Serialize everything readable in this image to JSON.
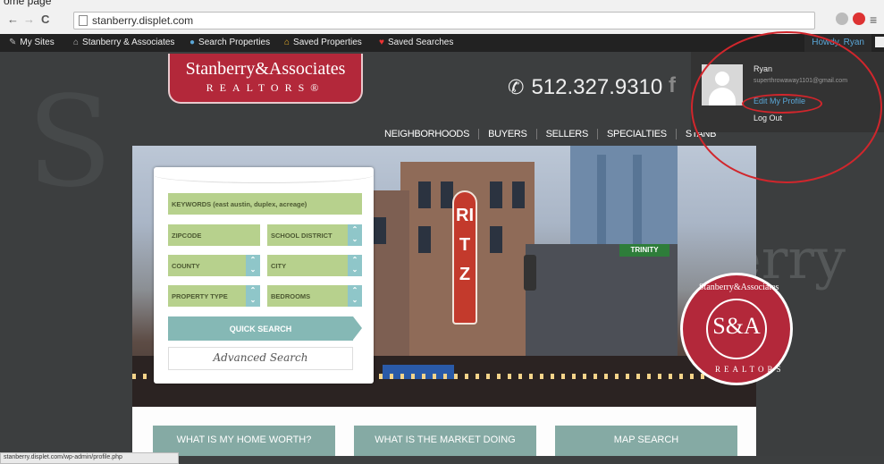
{
  "browser": {
    "partial_title": "ome page",
    "url": "stanberry.displet.com",
    "status_url": "stanberry.displet.com/wp-admin/profile.php"
  },
  "adminbar": {
    "items": [
      {
        "label": "My Sites",
        "icon": "wrench-icon"
      },
      {
        "label": "Stanberry & Associates",
        "icon": "home-icon"
      },
      {
        "label": "Search Properties",
        "icon": "search-icon"
      },
      {
        "label": "Saved Properties",
        "icon": "house-icon"
      },
      {
        "label": "Saved Searches",
        "icon": "heart-icon"
      }
    ],
    "howdy": "Howdy, Ryan"
  },
  "user_menu": {
    "name": "Ryan",
    "email": "superthrowaway1101@gmail.com",
    "edit_profile": "Edit My Profile",
    "logout": "Log Out"
  },
  "site": {
    "logo_line1": "Stanberry&Associates",
    "logo_line2": "REALTORS®",
    "phone": "512.327.9310",
    "nav": [
      "NEIGHBORHOODS",
      "BUYERS",
      "SELLERS",
      "SPECIALTIES",
      "STANB"
    ],
    "watermark": "erry"
  },
  "search": {
    "keywords": "KEYWORDS (east austin, duplex, acreage)",
    "zipcode": "ZIPCODE",
    "school_district": "SCHOOL DISTRICT",
    "county": "COUNTY",
    "city": "CITY",
    "property_type": "PROPERTY TYPE",
    "bedrooms": "BEDROOMS",
    "quick_search": "QUICK SEARCH",
    "advanced_search": "Advanced Search"
  },
  "hero": {
    "sign_text": "RITZ",
    "street_sign": "TRINITY"
  },
  "seal": {
    "top": "Stanberry&Associates",
    "center": "S&A",
    "bottom": "REALTORS"
  },
  "cta": [
    "WHAT IS MY HOME WORTH?",
    "WHAT IS THE MARKET DOING",
    "MAP SEARCH"
  ],
  "colors": {
    "brand_red": "#b3283a",
    "field_green": "#b7d18d",
    "teal": "#85b8b5",
    "annotation_red": "#d1262c"
  }
}
